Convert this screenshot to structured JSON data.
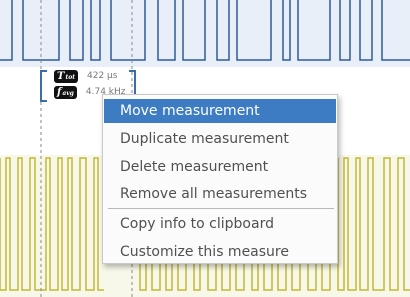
{
  "measurement": {
    "period_symbol": "T",
    "period_subscript": "tot",
    "period_value": "422 µs",
    "freq_symbol": "f",
    "freq_subscript": "avg",
    "freq_value": "4.74 kHz"
  },
  "context_menu": {
    "items": [
      {
        "label": "Move measurement",
        "highlighted": true
      },
      {
        "label": "Duplicate measurement"
      },
      {
        "label": "Delete measurement"
      },
      {
        "label": "Remove all measurements"
      },
      {
        "label": "Copy info to clipboard"
      },
      {
        "label": "Customize this measure"
      }
    ]
  },
  "colors": {
    "channel_1": "#2f5a9a",
    "channel_2": "#c4b733",
    "highlight": "#3d7cc3"
  }
}
